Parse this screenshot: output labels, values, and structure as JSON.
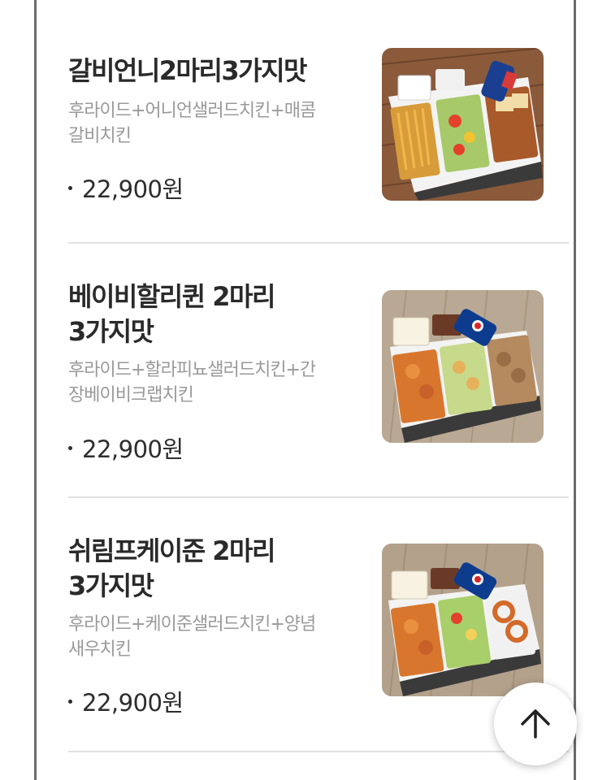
{
  "menu": {
    "items": [
      {
        "title_lines": [
          "갈비언니2마리3가지맛"
        ],
        "description_lines": [
          "후라이드+어니언샐러드치킨+매콤",
          "갈비치킨"
        ],
        "price": "22,900원",
        "image": "galbi-unni-chicken-box-photo"
      },
      {
        "title_lines": [
          "베이비할리퀸 2마리",
          "3가지맛"
        ],
        "description_lines": [
          "후라이드+할라피뇨샐러드치킨+간",
          "장베이비크랩치킨"
        ],
        "price": "22,900원",
        "image": "baby-harlequin-chicken-box-photo"
      },
      {
        "title_lines": [
          "쉬림프케이준 2마리",
          "3가지맛"
        ],
        "description_lines": [
          "후라이드+케이준샐러드치킨+양념",
          "새우치킨"
        ],
        "price": "22,900원",
        "image": "shrimp-cajun-chicken-box-photo"
      }
    ]
  },
  "scroll_top_button": {
    "icon": "arrow-up-icon"
  },
  "colors": {
    "title": "#2a2a2a",
    "description": "#9a9a9a",
    "divider": "#e2e2e2",
    "frame": "#6b6b6b"
  }
}
